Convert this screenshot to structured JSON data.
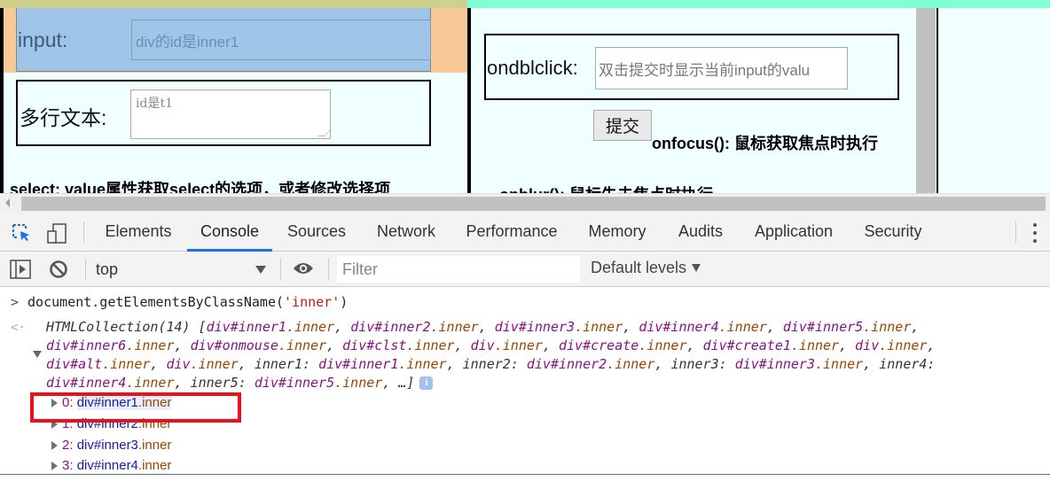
{
  "page": {
    "input_label": "input:",
    "input_placeholder": "div的id是inner1",
    "textarea_label": "多行文本:",
    "textarea_placeholder": "id是t1",
    "select_heading": "select: value属性获取select的选项，或者修改选择项",
    "ondblclick_label": "ondblclick:",
    "ondblclick_placeholder": "双击提交时显示当前input的valu",
    "submit_button": "提交",
    "onfocus_heading": "onfocus(): 鼠标获取焦点时执行",
    "onblur_heading": "onblur(): 鼠标失去焦点时执行"
  },
  "devtools": {
    "tabs": [
      "Elements",
      "Console",
      "Sources",
      "Network",
      "Performance",
      "Memory",
      "Audits",
      "Application",
      "Security"
    ],
    "active_tab": "Console",
    "context": "top",
    "filter_placeholder": "Filter",
    "levels": "Default levels"
  },
  "console": {
    "input": {
      "prefix": "document.getElementsByClassName(",
      "arg": "'inner'",
      "suffix": ")"
    },
    "result_head": "HTMLCollection(14) [",
    "result_items": [
      {
        "tag": "div#inner1",
        "cls": ".inner"
      },
      {
        "tag": "div#inner2",
        "cls": ".inner"
      },
      {
        "tag": "div#inner3",
        "cls": ".inner"
      },
      {
        "tag": "div#inner4",
        "cls": ".inner"
      },
      {
        "tag": "div#inner5",
        "cls": ".inner"
      },
      {
        "tag": "div#inner6",
        "cls": ".inner"
      },
      {
        "tag": "div#onmouse",
        "cls": ".inner"
      },
      {
        "tag": "div#clst",
        "cls": ".inner"
      },
      {
        "tag": "div",
        "cls": ".inner"
      },
      {
        "tag": "div#create",
        "cls": ".inner"
      },
      {
        "tag": "div#create1",
        "cls": ".inner"
      },
      {
        "tag": "div",
        "cls": ".inner"
      },
      {
        "tag": "div#alt",
        "cls": ".inner"
      },
      {
        "tag": "div",
        "cls": ".inner"
      }
    ],
    "result_named": [
      {
        "key": "inner1",
        "tag": "div#inner1",
        "cls": ".inner"
      },
      {
        "key": "inner2",
        "tag": "div#inner2",
        "cls": ".inner"
      },
      {
        "key": "inner3",
        "tag": "div#inner3",
        "cls": ".inner"
      },
      {
        "key": "inner4",
        "tag": "div#inner4",
        "cls": ".inner"
      },
      {
        "key": "inner5",
        "tag": "div#inner5",
        "cls": ".inner"
      }
    ],
    "result_tail": "…]",
    "expanded": [
      {
        "index": "0:",
        "tag": "div#inner1",
        "cls": ".inner"
      },
      {
        "index": "1:",
        "tag": "div#inner2",
        "cls": ".inner"
      },
      {
        "index": "2:",
        "tag": "div#inner3",
        "cls": ".inner"
      },
      {
        "index": "3:",
        "tag": "div#inner4",
        "cls": ".inner"
      }
    ]
  },
  "colors": {
    "highlight_content": "#9fc5e8",
    "highlight_margin": "#f6c996",
    "active_tab_underline": "#1a73e8",
    "annotation_box": "#e8111c"
  }
}
